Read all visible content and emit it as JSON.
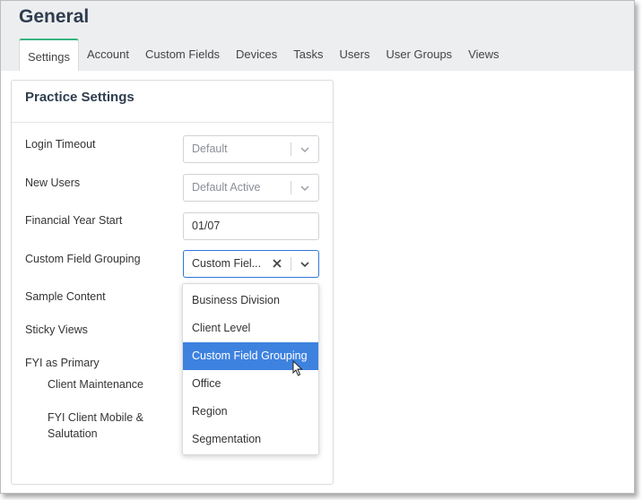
{
  "header": {
    "title": "General",
    "tabs": [
      {
        "label": "Settings",
        "active": true
      },
      {
        "label": "Account"
      },
      {
        "label": "Custom Fields"
      },
      {
        "label": "Devices"
      },
      {
        "label": "Tasks"
      },
      {
        "label": "Users"
      },
      {
        "label": "User Groups"
      },
      {
        "label": "Views"
      }
    ]
  },
  "card": {
    "title": "Practice Settings",
    "login_timeout": {
      "label": "Login Timeout",
      "value": "Default"
    },
    "new_users": {
      "label": "New Users",
      "value": "Default Active"
    },
    "financial_year_start": {
      "label": "Financial Year Start",
      "value": "01/07"
    },
    "custom_field_grouping": {
      "label": "Custom Field Grouping",
      "value": "Custom Fiel...",
      "options": [
        "Business Division",
        "Client Level",
        "Custom Field Grouping",
        "Office",
        "Region",
        "Segmentation"
      ],
      "highlighted": "Custom Field Grouping"
    },
    "sample_content": {
      "label": "Sample Content"
    },
    "sticky_views": {
      "label": "Sticky Views"
    },
    "fyi_as_primary": {
      "label": "FYI as Primary"
    },
    "client_maintenance": {
      "label": "Client Maintenance"
    },
    "fyi_client_mobile": {
      "label_line1": "FYI Client Mobile &",
      "label_line2": "Salutation"
    }
  },
  "colors": {
    "accent_tab": "#37b47e",
    "focus_border": "#2e78d6",
    "option_selected_bg": "#3e82e0",
    "header_bg": "#edeef0",
    "title_color": "#2f3d4e"
  }
}
